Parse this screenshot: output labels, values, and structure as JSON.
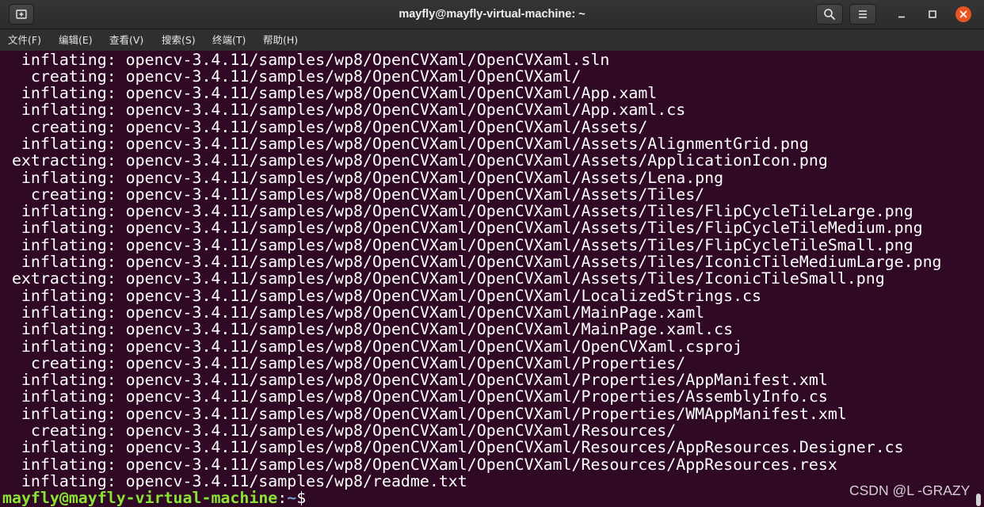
{
  "window": {
    "title": "mayfly@mayfly-virtual-machine: ~",
    "icons": {
      "new_tab": "tab-new-icon",
      "search": "search-icon",
      "menu": "hamburger-menu-icon",
      "minimize": "minimize-icon",
      "maximize": "maximize-icon",
      "close": "close-icon"
    },
    "colors": {
      "close_button": "#e95420"
    }
  },
  "menubar": {
    "items": [
      {
        "label": "文件(F)"
      },
      {
        "label": "编辑(E)"
      },
      {
        "label": "查看(V)"
      },
      {
        "label": "搜索(S)"
      },
      {
        "label": "终端(T)"
      },
      {
        "label": "帮助(H)"
      }
    ]
  },
  "terminal": {
    "colors": {
      "background": "#300a24",
      "foreground": "#ffffff",
      "prompt_user_host": "#8ae234",
      "prompt_cwd": "#729fcf"
    },
    "output": [
      {
        "action": "inflating:",
        "path": "opencv-3.4.11/samples/wp8/OpenCVXaml/OpenCVXaml.sln"
      },
      {
        "action": "creating:",
        "path": "opencv-3.4.11/samples/wp8/OpenCVXaml/OpenCVXaml/"
      },
      {
        "action": "inflating:",
        "path": "opencv-3.4.11/samples/wp8/OpenCVXaml/OpenCVXaml/App.xaml"
      },
      {
        "action": "inflating:",
        "path": "opencv-3.4.11/samples/wp8/OpenCVXaml/OpenCVXaml/App.xaml.cs"
      },
      {
        "action": "creating:",
        "path": "opencv-3.4.11/samples/wp8/OpenCVXaml/OpenCVXaml/Assets/"
      },
      {
        "action": "inflating:",
        "path": "opencv-3.4.11/samples/wp8/OpenCVXaml/OpenCVXaml/Assets/AlignmentGrid.png"
      },
      {
        "action": "extracting:",
        "path": "opencv-3.4.11/samples/wp8/OpenCVXaml/OpenCVXaml/Assets/ApplicationIcon.png"
      },
      {
        "action": "inflating:",
        "path": "opencv-3.4.11/samples/wp8/OpenCVXaml/OpenCVXaml/Assets/Lena.png"
      },
      {
        "action": "creating:",
        "path": "opencv-3.4.11/samples/wp8/OpenCVXaml/OpenCVXaml/Assets/Tiles/"
      },
      {
        "action": "inflating:",
        "path": "opencv-3.4.11/samples/wp8/OpenCVXaml/OpenCVXaml/Assets/Tiles/FlipCycleTileLarge.png"
      },
      {
        "action": "inflating:",
        "path": "opencv-3.4.11/samples/wp8/OpenCVXaml/OpenCVXaml/Assets/Tiles/FlipCycleTileMedium.png"
      },
      {
        "action": "inflating:",
        "path": "opencv-3.4.11/samples/wp8/OpenCVXaml/OpenCVXaml/Assets/Tiles/FlipCycleTileSmall.png"
      },
      {
        "action": "inflating:",
        "path": "opencv-3.4.11/samples/wp8/OpenCVXaml/OpenCVXaml/Assets/Tiles/IconicTileMediumLarge.png"
      },
      {
        "action": "extracting:",
        "path": "opencv-3.4.11/samples/wp8/OpenCVXaml/OpenCVXaml/Assets/Tiles/IconicTileSmall.png"
      },
      {
        "action": "inflating:",
        "path": "opencv-3.4.11/samples/wp8/OpenCVXaml/OpenCVXaml/LocalizedStrings.cs"
      },
      {
        "action": "inflating:",
        "path": "opencv-3.4.11/samples/wp8/OpenCVXaml/OpenCVXaml/MainPage.xaml"
      },
      {
        "action": "inflating:",
        "path": "opencv-3.4.11/samples/wp8/OpenCVXaml/OpenCVXaml/MainPage.xaml.cs"
      },
      {
        "action": "inflating:",
        "path": "opencv-3.4.11/samples/wp8/OpenCVXaml/OpenCVXaml/OpenCVXaml.csproj"
      },
      {
        "action": "creating:",
        "path": "opencv-3.4.11/samples/wp8/OpenCVXaml/OpenCVXaml/Properties/"
      },
      {
        "action": "inflating:",
        "path": "opencv-3.4.11/samples/wp8/OpenCVXaml/OpenCVXaml/Properties/AppManifest.xml"
      },
      {
        "action": "inflating:",
        "path": "opencv-3.4.11/samples/wp8/OpenCVXaml/OpenCVXaml/Properties/AssemblyInfo.cs"
      },
      {
        "action": "inflating:",
        "path": "opencv-3.4.11/samples/wp8/OpenCVXaml/OpenCVXaml/Properties/WMAppManifest.xml"
      },
      {
        "action": "creating:",
        "path": "opencv-3.4.11/samples/wp8/OpenCVXaml/OpenCVXaml/Resources/"
      },
      {
        "action": "inflating:",
        "path": "opencv-3.4.11/samples/wp8/OpenCVXaml/OpenCVXaml/Resources/AppResources.Designer.cs"
      },
      {
        "action": "inflating:",
        "path": "opencv-3.4.11/samples/wp8/OpenCVXaml/OpenCVXaml/Resources/AppResources.resx"
      },
      {
        "action": "inflating:",
        "path": "opencv-3.4.11/samples/wp8/readme.txt"
      }
    ],
    "prompt": {
      "user_host": "mayfly@mayfly-virtual-machine",
      "separator": ":",
      "cwd": "~",
      "symbol": "$"
    }
  },
  "watermark": {
    "text": "CSDN @L -GRAZY"
  }
}
